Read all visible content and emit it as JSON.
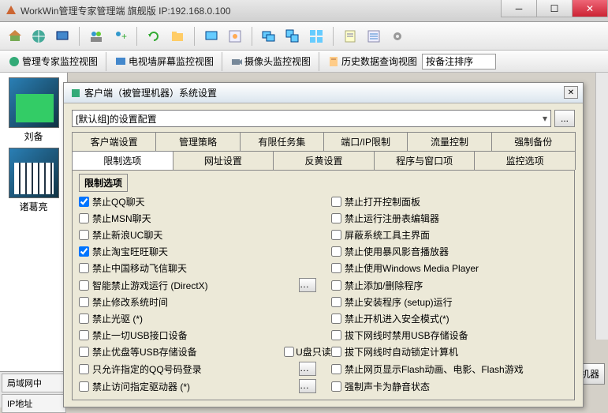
{
  "main": {
    "title": "WorkWin管理专家管理端   旗舰版 IP:192.168.0.100"
  },
  "toolbar2": {
    "view1": "管理专家监控视图",
    "view2": "电视墙屏幕监控视图",
    "view3": "摄像头监控视图",
    "view4": "历史数据查询视图",
    "sort_value": "按备注排序"
  },
  "thumbs": {
    "t1": "刘备",
    "t2": "诸葛亮"
  },
  "bottom": {
    "tab1": "局域网中",
    "tab2": "IP地址"
  },
  "right_btn": "监视机器",
  "dialog": {
    "title": "客户端（被管理机器）系统设置",
    "combo_value": "[默认组]的设置配置",
    "browse": "...",
    "tabs_row1": [
      "客户端设置",
      "管理策略",
      "有限任务集",
      "端口/IP限制",
      "流量控制",
      "强制备份"
    ],
    "tabs_row2": [
      "限制选项",
      "网址设置",
      "反黄设置",
      "程序与窗口项",
      "监控选项"
    ],
    "active_tab": "限制选项",
    "group_label": "限制选项",
    "udisk_readonly": "U盘只读",
    "left_opts": [
      {
        "label": "禁止QQ聊天",
        "checked": true
      },
      {
        "label": "禁止MSN聊天",
        "checked": false
      },
      {
        "label": "禁止新浪UC聊天",
        "checked": false
      },
      {
        "label": "禁止淘宝旺旺聊天",
        "checked": true
      },
      {
        "label": "禁止中国移动飞信聊天",
        "checked": false
      },
      {
        "label": "智能禁止游戏运行 (DirectX)",
        "checked": false,
        "btn": true
      },
      {
        "label": "禁止修改系统时间",
        "checked": false
      },
      {
        "label": "禁止光驱 (*)",
        "checked": false
      },
      {
        "label": "禁止一切USB接口设备",
        "checked": false
      },
      {
        "label": "禁止优盘等USB存储设备",
        "checked": false,
        "mid_chk": true
      },
      {
        "label": "只允许指定的QQ号码登录",
        "checked": false,
        "btn": true
      },
      {
        "label": "禁止访问指定驱动器 (*)",
        "checked": false,
        "btn": true
      }
    ],
    "right_opts": [
      {
        "label": "禁止打开控制面板",
        "checked": false
      },
      {
        "label": "禁止运行注册表编辑器",
        "checked": false
      },
      {
        "label": "屏蔽系统工具主界面",
        "checked": false
      },
      {
        "label": "禁止使用暴风影音播放器",
        "checked": false
      },
      {
        "label": "禁止使用Windows Media Player",
        "checked": false
      },
      {
        "label": "禁止添加/删除程序",
        "checked": false
      },
      {
        "label": "禁止安装程序 (setup)运行",
        "checked": false
      },
      {
        "label": "禁止开机进入安全模式(*)",
        "checked": false
      },
      {
        "label": "拔下网线时禁用USB存储设备",
        "checked": false
      },
      {
        "label": "拔下网线时自动锁定计算机",
        "checked": false
      },
      {
        "label": "禁止网页显示Flash动画、电影、Flash游戏",
        "checked": false
      },
      {
        "label": "强制声卡为静音状态",
        "checked": false
      }
    ]
  }
}
